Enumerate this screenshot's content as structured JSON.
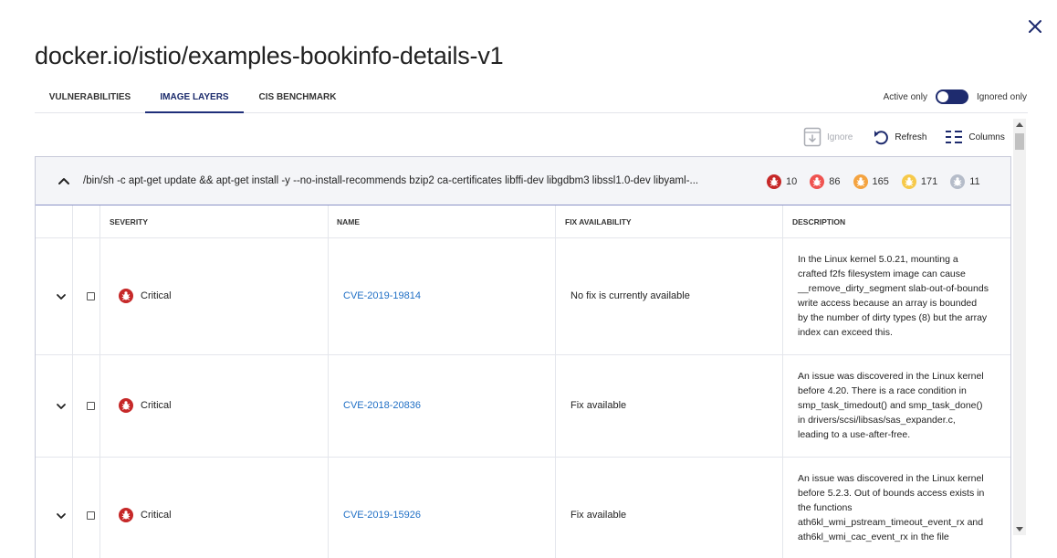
{
  "title": "docker.io/istio/examples-bookinfo-details-v1",
  "tabs": [
    {
      "label": "VULNERABILITIES"
    },
    {
      "label": "IMAGE LAYERS"
    },
    {
      "label": "CIS BENCHMARK"
    }
  ],
  "active_tab": "IMAGE LAYERS",
  "toggle": {
    "left_label": "Active only",
    "right_label": "Ignored only"
  },
  "toolbar": {
    "ignore": "Ignore",
    "refresh": "Refresh",
    "columns": "Columns"
  },
  "layer": {
    "command": "/bin/sh -c apt-get update && apt-get install -y --no-install-recommends bzip2 ca-certificates libffi-dev libgdbm3 libssl1.0-dev libyaml-...",
    "counts": [
      {
        "value": "10",
        "color": "#c62828"
      },
      {
        "value": "86",
        "color": "#ef5350"
      },
      {
        "value": "165",
        "color": "#f4a340"
      },
      {
        "value": "171",
        "color": "#f6c94a"
      },
      {
        "value": "11",
        "color": "#b5bcc9"
      }
    ]
  },
  "table": {
    "headers": {
      "severity": "SEVERITY",
      "name": "NAME",
      "fix": "FIX AVAILABILITY",
      "description": "DESCRIPTION"
    },
    "rows": [
      {
        "severity": "Critical",
        "name": "CVE-2019-19814",
        "fix": "No fix is currently available",
        "description_lines": [
          "In the Linux kernel 5.0.21, mounting a",
          "crafted f2fs filesystem image can cause",
          "__remove_dirty_segment slab-out-of-bounds",
          "write access because an array is bounded",
          "by the number of dirty types (8) but the array",
          "index can exceed this."
        ]
      },
      {
        "severity": "Critical",
        "name": "CVE-2018-20836",
        "fix": "Fix available",
        "description_lines": [
          "An issue was discovered in the Linux kernel",
          "before 4.20. There is a race condition in",
          "smp_task_timedout() and smp_task_done()",
          "in drivers/scsi/libsas/sas_expander.c,",
          "leading to a use-after-free."
        ]
      },
      {
        "severity": "Critical",
        "name": "CVE-2019-15926",
        "fix": "Fix available",
        "description_lines": [
          "An issue was discovered in the Linux kernel",
          "before 5.2.3. Out of bounds access exists in",
          "the functions",
          "ath6kl_wmi_pstream_timeout_event_rx and",
          "ath6kl_wmi_cac_event_rx in the file"
        ]
      }
    ]
  },
  "colors": {
    "accent": "#1e2b6e",
    "link": "#1f6fc5",
    "critical": "#c62828"
  }
}
